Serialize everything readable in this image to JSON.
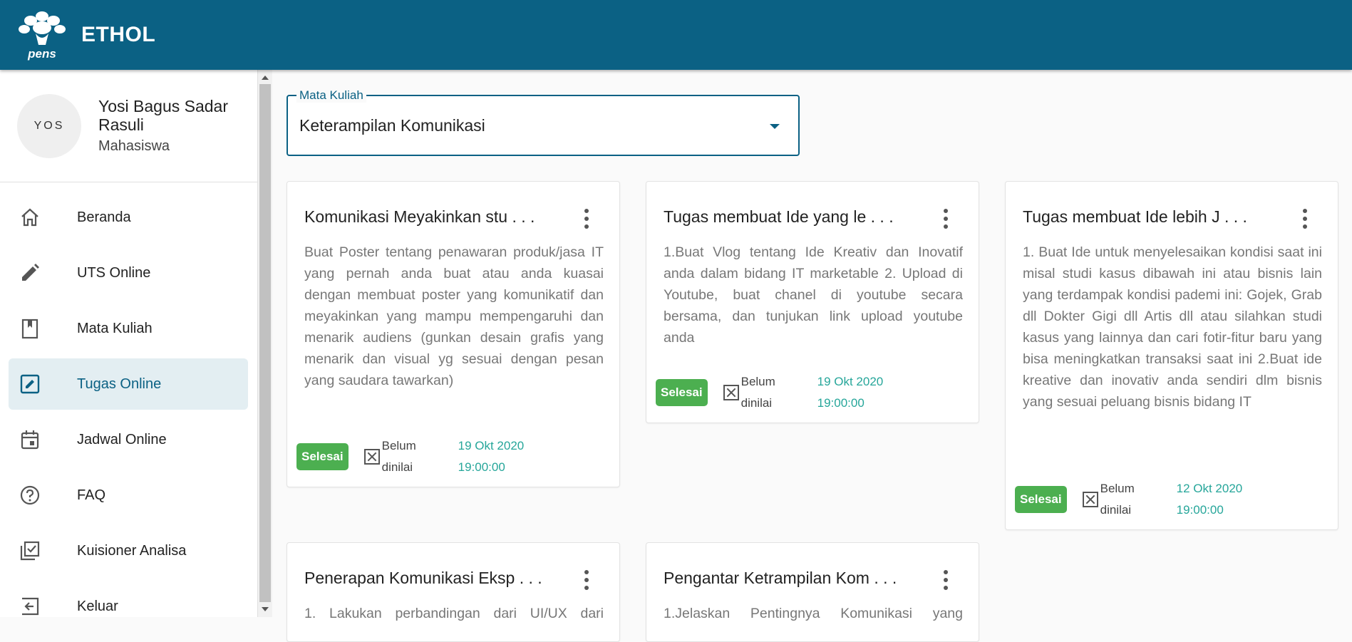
{
  "app": {
    "title": "ETHOL",
    "logo_text": "pens"
  },
  "profile": {
    "initials": "YOS",
    "name": "Yosi Bagus Sadar Rasuli",
    "role": "Mahasiswa"
  },
  "nav": [
    {
      "label": "Beranda",
      "icon": "home-icon"
    },
    {
      "label": "UTS Online",
      "icon": "pencil-icon"
    },
    {
      "label": "Mata Kuliah",
      "icon": "bookmark-icon"
    },
    {
      "label": "Tugas Online",
      "icon": "edit-box-icon",
      "active": true
    },
    {
      "label": "Jadwal Online",
      "icon": "calendar-icon"
    },
    {
      "label": "FAQ",
      "icon": "help-circle-icon"
    },
    {
      "label": "Kuisioner Analisa",
      "icon": "checklist-icon"
    },
    {
      "label": "Keluar",
      "icon": "logout-icon"
    }
  ],
  "filter": {
    "label": "Mata Kuliah",
    "value": "Keterampilan Komunikasi"
  },
  "cards": [
    {
      "title": "Komunikasi Meyakinkan stu . . .",
      "description": "Buat Poster tentang penawaran produk/jasa IT yang pernah anda buat atau anda kuasai dengan membuat poster yang komunikatif dan meyakinkan yang mampu mempengaruhi dan menarik audiens (gunkan desain grafis yang menarik dan visual yg sesuai dengan pesan yang saudara tawarkan)",
      "badge": "Selesai",
      "status": "Belum dinilai",
      "due_date": "19 Okt 2020",
      "due_time": "19:00:00"
    },
    {
      "title": "Tugas membuat Ide yang le . . .",
      "description": "1.Buat Vlog tentang Ide Kreativ dan Inovatif anda dalam bidang IT marketable 2. Upload di Youtube, buat chanel di youtube secara bersama, dan tunjukan link upload youtube anda",
      "badge": "Selesai",
      "status": "Belum dinilai",
      "due_date": "19 Okt 2020",
      "due_time": "19:00:00"
    },
    {
      "title": "Tugas membuat Ide lebih J . . .",
      "description": "1. Buat Ide untuk menyelesaikan kondisi saat ini misal studi kasus dibawah ini atau bisnis lain yang terdampak kondisi pademi ini: Gojek, Grab dll Dokter Gigi dll Artis dll atau silahkan studi kasus yang lainnya dan cari fotir-fitur baru yang bisa meningkatkan transaksi saat ini 2.Buat ide kreative dan inovativ anda sendiri dlm bisnis yang sesuai peluang bisnis bidang IT",
      "badge": "Selesai",
      "status": "Belum dinilai",
      "due_date": "12 Okt 2020",
      "due_time": "19:00:00"
    },
    {
      "title": "Penerapan Komunikasi Eksp . . .",
      "description": "1. Lakukan perbandingan dari UI/UX dari"
    },
    {
      "title": "Pengantar Ketrampilan Kom . . .",
      "description": "1.Jelaskan Pentingnya Komunikasi yang"
    }
  ]
}
